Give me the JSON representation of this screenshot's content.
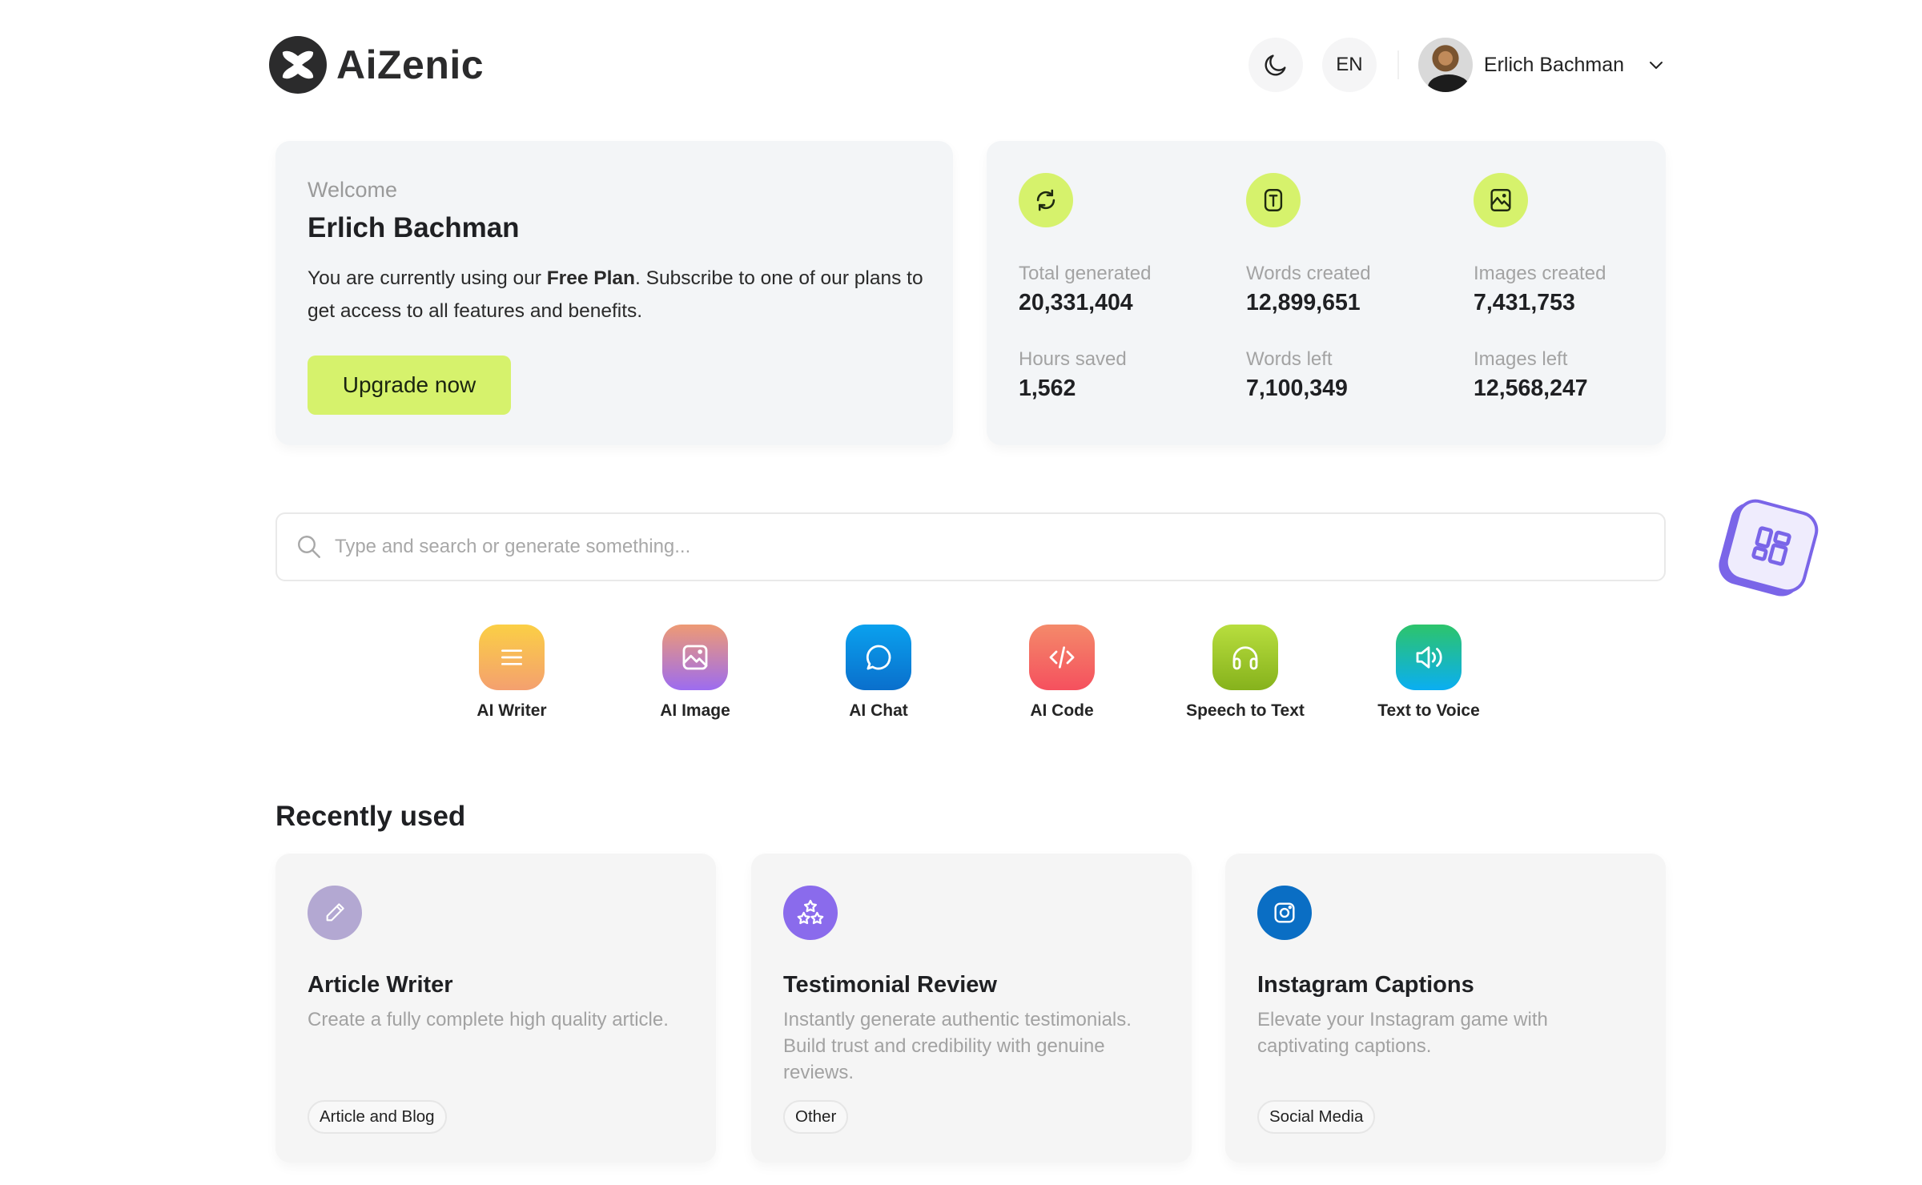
{
  "header": {
    "brand_name": "AiZenic",
    "theme_toggle_icon": "moon-icon",
    "language": "EN",
    "user_name": "Erlich Bachman",
    "user_menu_icon": "chevron-down-icon"
  },
  "welcome": {
    "label": "Welcome",
    "name": "Erlich Bachman",
    "text_before": "You are currently using our ",
    "plan": "Free Plan",
    "text_after": ". Subscribe to one of our plans to get access to all features and benefits.",
    "upgrade_label": "Upgrade now"
  },
  "stats": {
    "icons": [
      "refresh-icon",
      "text-icon",
      "image-icon"
    ],
    "items": [
      {
        "label": "Total generated",
        "value": "20,331,404"
      },
      {
        "label": "Words created",
        "value": "12,899,651"
      },
      {
        "label": "Images created",
        "value": "7,431,753"
      },
      {
        "label": "Hours saved",
        "value": "1,562"
      },
      {
        "label": "Words left",
        "value": "7,100,349"
      },
      {
        "label": "Images left",
        "value": "12,568,247"
      }
    ],
    "accent_color": "#d6f26c"
  },
  "search": {
    "placeholder": "Type and search or generate something...",
    "value": ""
  },
  "tools": [
    {
      "label": "AI Writer",
      "icon": "text-lines-icon",
      "gradient": [
        "#fbcf45",
        "#f4a06f"
      ]
    },
    {
      "label": "AI Image",
      "icon": "image-icon",
      "gradient": [
        "#ee9a74",
        "#9d6cf0"
      ]
    },
    {
      "label": "AI Chat",
      "icon": "chat-bubble-icon",
      "gradient": [
        "#0aa1ee",
        "#0a6fcc"
      ]
    },
    {
      "label": "AI Code",
      "icon": "code-icon",
      "gradient": [
        "#f48a6a",
        "#f5505e"
      ]
    },
    {
      "label": "Speech to Text",
      "icon": "headphones-icon",
      "gradient": [
        "#b8de3e",
        "#86b21c"
      ]
    },
    {
      "label": "Text to Voice",
      "icon": "speaker-icon",
      "gradient": [
        "#2dc46b",
        "#0aaef2"
      ]
    }
  ],
  "recent": {
    "title": "Recently used",
    "items": [
      {
        "title": "Article Writer",
        "description": "Create a fully complete high quality article.",
        "tag": "Article and Blog",
        "icon": "pencil-icon",
        "color": "#b3a8d2"
      },
      {
        "title": "Testimonial Review",
        "description": "Instantly generate authentic testimonials. Build trust and credibility with genuine reviews.",
        "tag": "Other",
        "icon": "stars-icon",
        "color": "#8a6bec"
      },
      {
        "title": "Instagram Captions",
        "description": "Elevate your Instagram game with captivating captions.",
        "tag": "Social Media",
        "icon": "instagram-icon",
        "color": "#0a6ec4"
      }
    ]
  },
  "floating_widget": {
    "icon": "apps-grid-icon",
    "color": "#7a65e8"
  }
}
